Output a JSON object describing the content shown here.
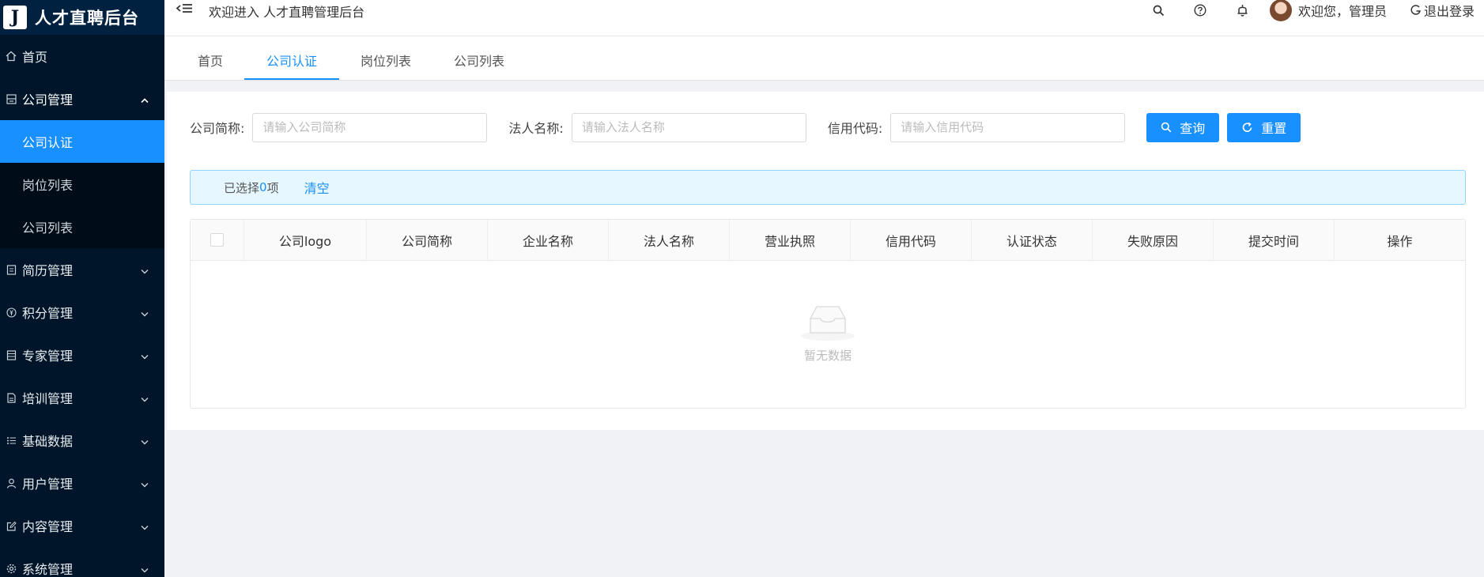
{
  "app": {
    "logo_letter": "J",
    "title": "人才直聘后台"
  },
  "header": {
    "welcome": "欢迎进入 人才直聘管理后台",
    "user_greeting": "欢迎您，管理员",
    "logout_label": "退出登录"
  },
  "sidebar": {
    "home": "首页",
    "company_mgmt": "公司管理",
    "sub_items": [
      "公司认证",
      "岗位列表",
      "公司列表"
    ],
    "items": [
      "简历管理",
      "积分管理",
      "专家管理",
      "培训管理",
      "基础数据",
      "用户管理",
      "内容管理",
      "系统管理"
    ]
  },
  "tabs": [
    "首页",
    "公司认证",
    "岗位列表",
    "公司列表"
  ],
  "search": {
    "short_name_label": "公司简称:",
    "short_name_placeholder": "请输入公司简称",
    "legal_label": "法人名称:",
    "legal_placeholder": "请输入法人名称",
    "credit_label": "信用代码:",
    "credit_placeholder": "请输入信用代码",
    "query_label": "查询",
    "reset_label": "重置"
  },
  "selection": {
    "prefix": "已选择 ",
    "count": "0",
    "suffix": "项",
    "clear_label": "清空"
  },
  "table": {
    "columns": [
      "公司logo",
      "公司简称",
      "企业名称",
      "法人名称",
      "营业执照",
      "信用代码",
      "认证状态",
      "失败原因",
      "提交时间",
      "操作"
    ],
    "rows": [],
    "empty_text": "暂无数据"
  },
  "colors": {
    "sidebar_bg": "#001529",
    "accent": "#1890ff",
    "alert_bg": "#e6f7ff"
  }
}
